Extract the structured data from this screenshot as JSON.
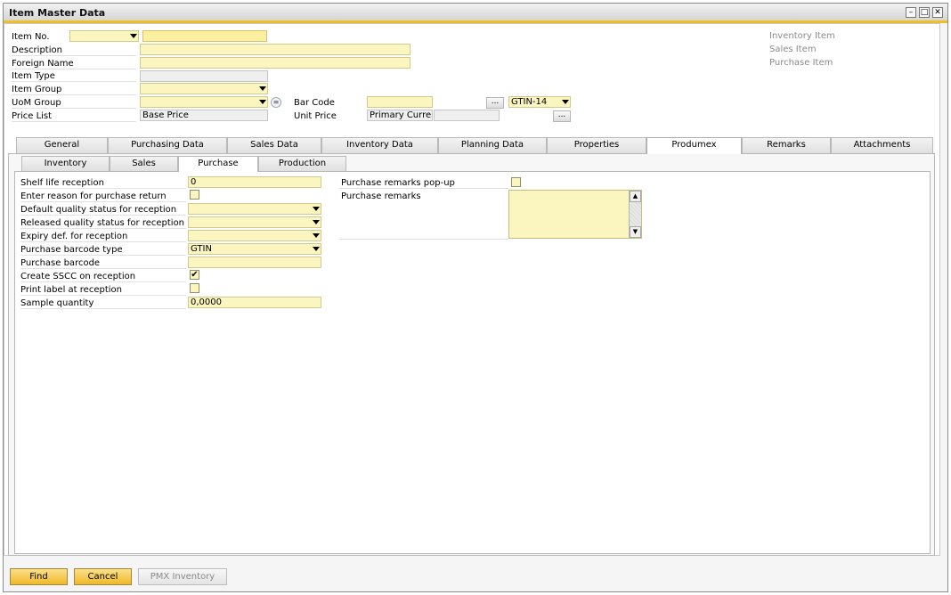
{
  "window": {
    "title": "Item Master Data"
  },
  "header": {
    "item_no_label": "Item No.",
    "description_label": "Description",
    "foreign_name_label": "Foreign Name",
    "item_type_label": "Item Type",
    "item_group_label": "Item Group",
    "uom_group_label": "UoM Group",
    "price_list_label": "Price List",
    "price_list_value": "Base Price",
    "bar_code_label": "Bar Code",
    "bar_code_type_value": "GTIN-14",
    "unit_price_label": "Unit Price",
    "unit_price_currency": "Primary Currenc",
    "dots": "...",
    "inventory_item_label": "Inventory Item",
    "sales_item_label": "Sales Item",
    "purchase_item_label": "Purchase Item"
  },
  "tabs": [
    {
      "label": "General"
    },
    {
      "label": "Purchasing Data"
    },
    {
      "label": "Sales Data"
    },
    {
      "label": "Inventory Data"
    },
    {
      "label": "Planning Data"
    },
    {
      "label": "Properties"
    },
    {
      "label": "Produmex"
    },
    {
      "label": "Remarks"
    },
    {
      "label": "Attachments"
    }
  ],
  "subtabs": [
    {
      "label": "Inventory"
    },
    {
      "label": "Sales"
    },
    {
      "label": "Purchase"
    },
    {
      "label": "Production"
    }
  ],
  "purchase": {
    "shelf_life_label": "Shelf life reception",
    "shelf_life_value": "0",
    "reason_return_label": "Enter reason for purchase return",
    "default_quality_label": "Default quality status for reception",
    "released_quality_label": "Released quality status for reception",
    "expiry_label": "Expiry def. for reception",
    "barcode_type_label": "Purchase barcode type",
    "barcode_type_value": "GTIN",
    "purchase_barcode_label": "Purchase barcode",
    "create_sscc_label": "Create SSCC on reception",
    "create_sscc_checked": true,
    "print_label_label": "Print label at reception",
    "sample_quantity_label": "Sample quantity",
    "sample_quantity_value": "0,0000",
    "remarks_popup_label": "Purchase remarks pop-up",
    "remarks_label": "Purchase remarks"
  },
  "buttons": {
    "find": "Find",
    "cancel": "Cancel",
    "pmx_inventory": "PMX Inventory"
  },
  "colors": {
    "field_yellow": "#fbf6bf",
    "accent_orange": "#f0b82a",
    "title_underline": "#f0c020"
  },
  "icons": {
    "minimize": "minimize-icon",
    "maximize": "maximize-icon",
    "close": "close-icon",
    "uom_info": "info-circle-icon"
  }
}
